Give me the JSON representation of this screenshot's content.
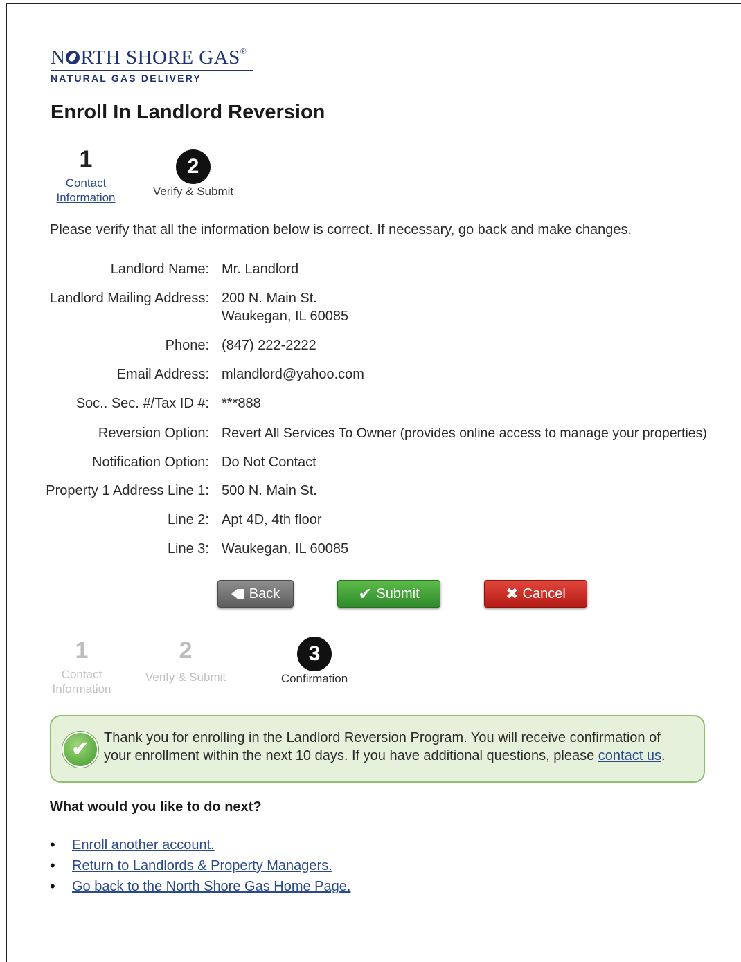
{
  "logo": {
    "name_pre": "N",
    "name_post": "RTH SHORE GAS",
    "reg": "®",
    "tagline": "NATURAL GAS DELIVERY"
  },
  "page_title": "Enroll In Landlord Reversion",
  "steps_top": [
    {
      "number": "1",
      "label_line1": "Contact",
      "label_line2": "Information"
    },
    {
      "number": "2",
      "label": "Verify & Submit"
    }
  ],
  "intro": "Please verify that all the information below is correct. If necessary, go back and make changes.",
  "details": [
    {
      "label": "Landlord Name:",
      "value": "Mr. Landlord"
    },
    {
      "label": "Landlord Mailing Address:",
      "value": "200 N. Main St.",
      "value2": "Waukegan, IL 60085"
    },
    {
      "label": "Phone:",
      "value": "(847) 222-2222"
    },
    {
      "label": "Email Address:",
      "value": "mlandlord@yahoo.com"
    },
    {
      "label": "Soc.. Sec. #/Tax ID #:",
      "value": "***888"
    },
    {
      "label": "Reversion Option:",
      "value": "Revert All Services To Owner (provides online access to manage your properties)"
    },
    {
      "label": "Notification Option:",
      "value": "Do Not Contact"
    },
    {
      "label": "Property 1 Address Line 1:",
      "value": "500 N. Main St."
    },
    {
      "label": "Line 2:",
      "value": "Apt 4D, 4th floor"
    },
    {
      "label": "Line 3:",
      "value": "Waukegan, IL 60085"
    }
  ],
  "buttons": {
    "back": "Back",
    "submit": "Submit",
    "cancel": "Cancel"
  },
  "steps_bottom": [
    {
      "number": "1",
      "label_line1": "Contact",
      "label_line2": "Information"
    },
    {
      "number": "2",
      "label": "Verify & Submit"
    },
    {
      "number": "3",
      "label": "Confirmation"
    }
  ],
  "confirmation": {
    "line1": "Thank you for enrolling in the Landlord Reversion Program. You will receive confirmation of",
    "line2_pre": "your enrollment within the next 10 days. If you have additional questions, please ",
    "link": "contact us",
    "line2_post": "."
  },
  "next": {
    "heading": "What would you like to do next?",
    "links": [
      "Enroll another account.",
      "Return to Landlords & Property Managers.",
      "Go back to the North Shore Gas Home Page."
    ]
  },
  "colors": {
    "brand": "#1f3272",
    "link": "#2a4a8c",
    "submit": "#3f9a2a",
    "cancel": "#c8241c",
    "back": "#777777",
    "confirm_bg": "#e6f1dc"
  },
  "icons": {
    "check": "checkmark-icon",
    "back": "back-arrow-icon",
    "cancel": "x-icon"
  }
}
